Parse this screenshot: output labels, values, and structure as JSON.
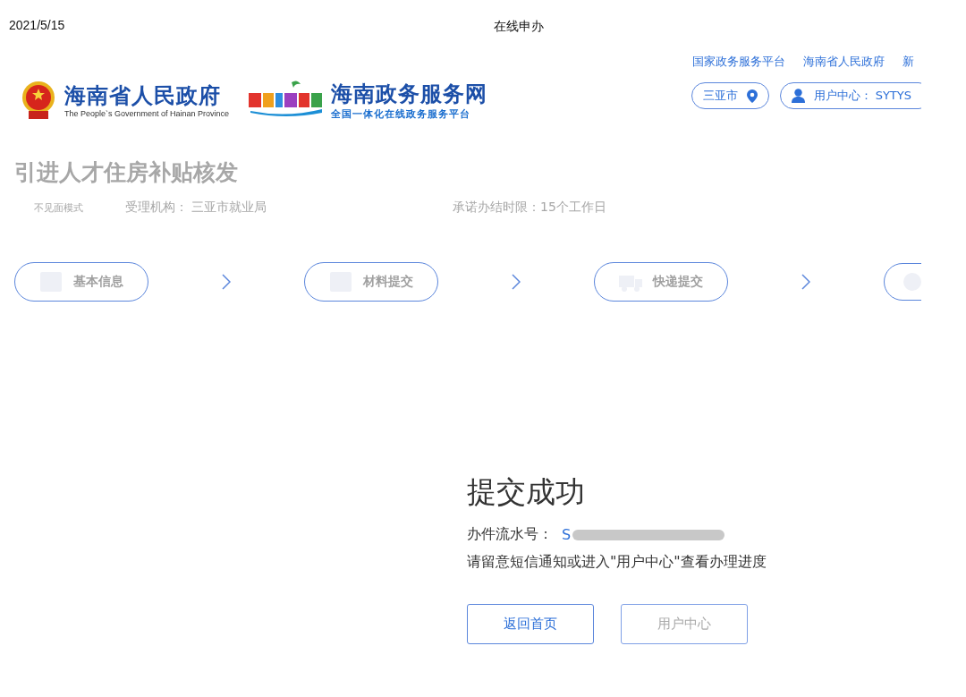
{
  "print_header": {
    "date": "2021/5/15",
    "title": "在线申办"
  },
  "header": {
    "gov_logo": {
      "title": "海南省人民政府",
      "subtitle": "The People`s Government of Hainan Province"
    },
    "portal_logo": {
      "title": "海南政务服务网",
      "subtitle": "全国一体化在线政务服务平台"
    },
    "links": [
      "国家政务服务平台",
      "海南省人民政府",
      "新"
    ],
    "city": "三亚市",
    "user": "用户中心： SYTYS"
  },
  "service": {
    "title": "引进人才住房补贴核发",
    "mode": "不见面模式",
    "agency": "受理机构： 三亚市就业局",
    "time_limit": "承诺办结时限：15个工作日"
  },
  "steps": [
    {
      "label": "基本信息",
      "kind": "form"
    },
    {
      "label": "材料提交",
      "kind": "upload"
    },
    {
      "label": "快递提交",
      "kind": "truck"
    },
    {
      "kind": "check"
    }
  ],
  "result": {
    "title": "提交成功",
    "serial_label": "办件流水号：",
    "serial_value": "S",
    "serial_redacted": true,
    "note": "请留意短信通知或进入\"用户中心\"查看办理进度",
    "buttons": [
      {
        "label": "返回首页",
        "disabled": false
      },
      {
        "label": "用户中心",
        "disabled": true
      }
    ]
  }
}
